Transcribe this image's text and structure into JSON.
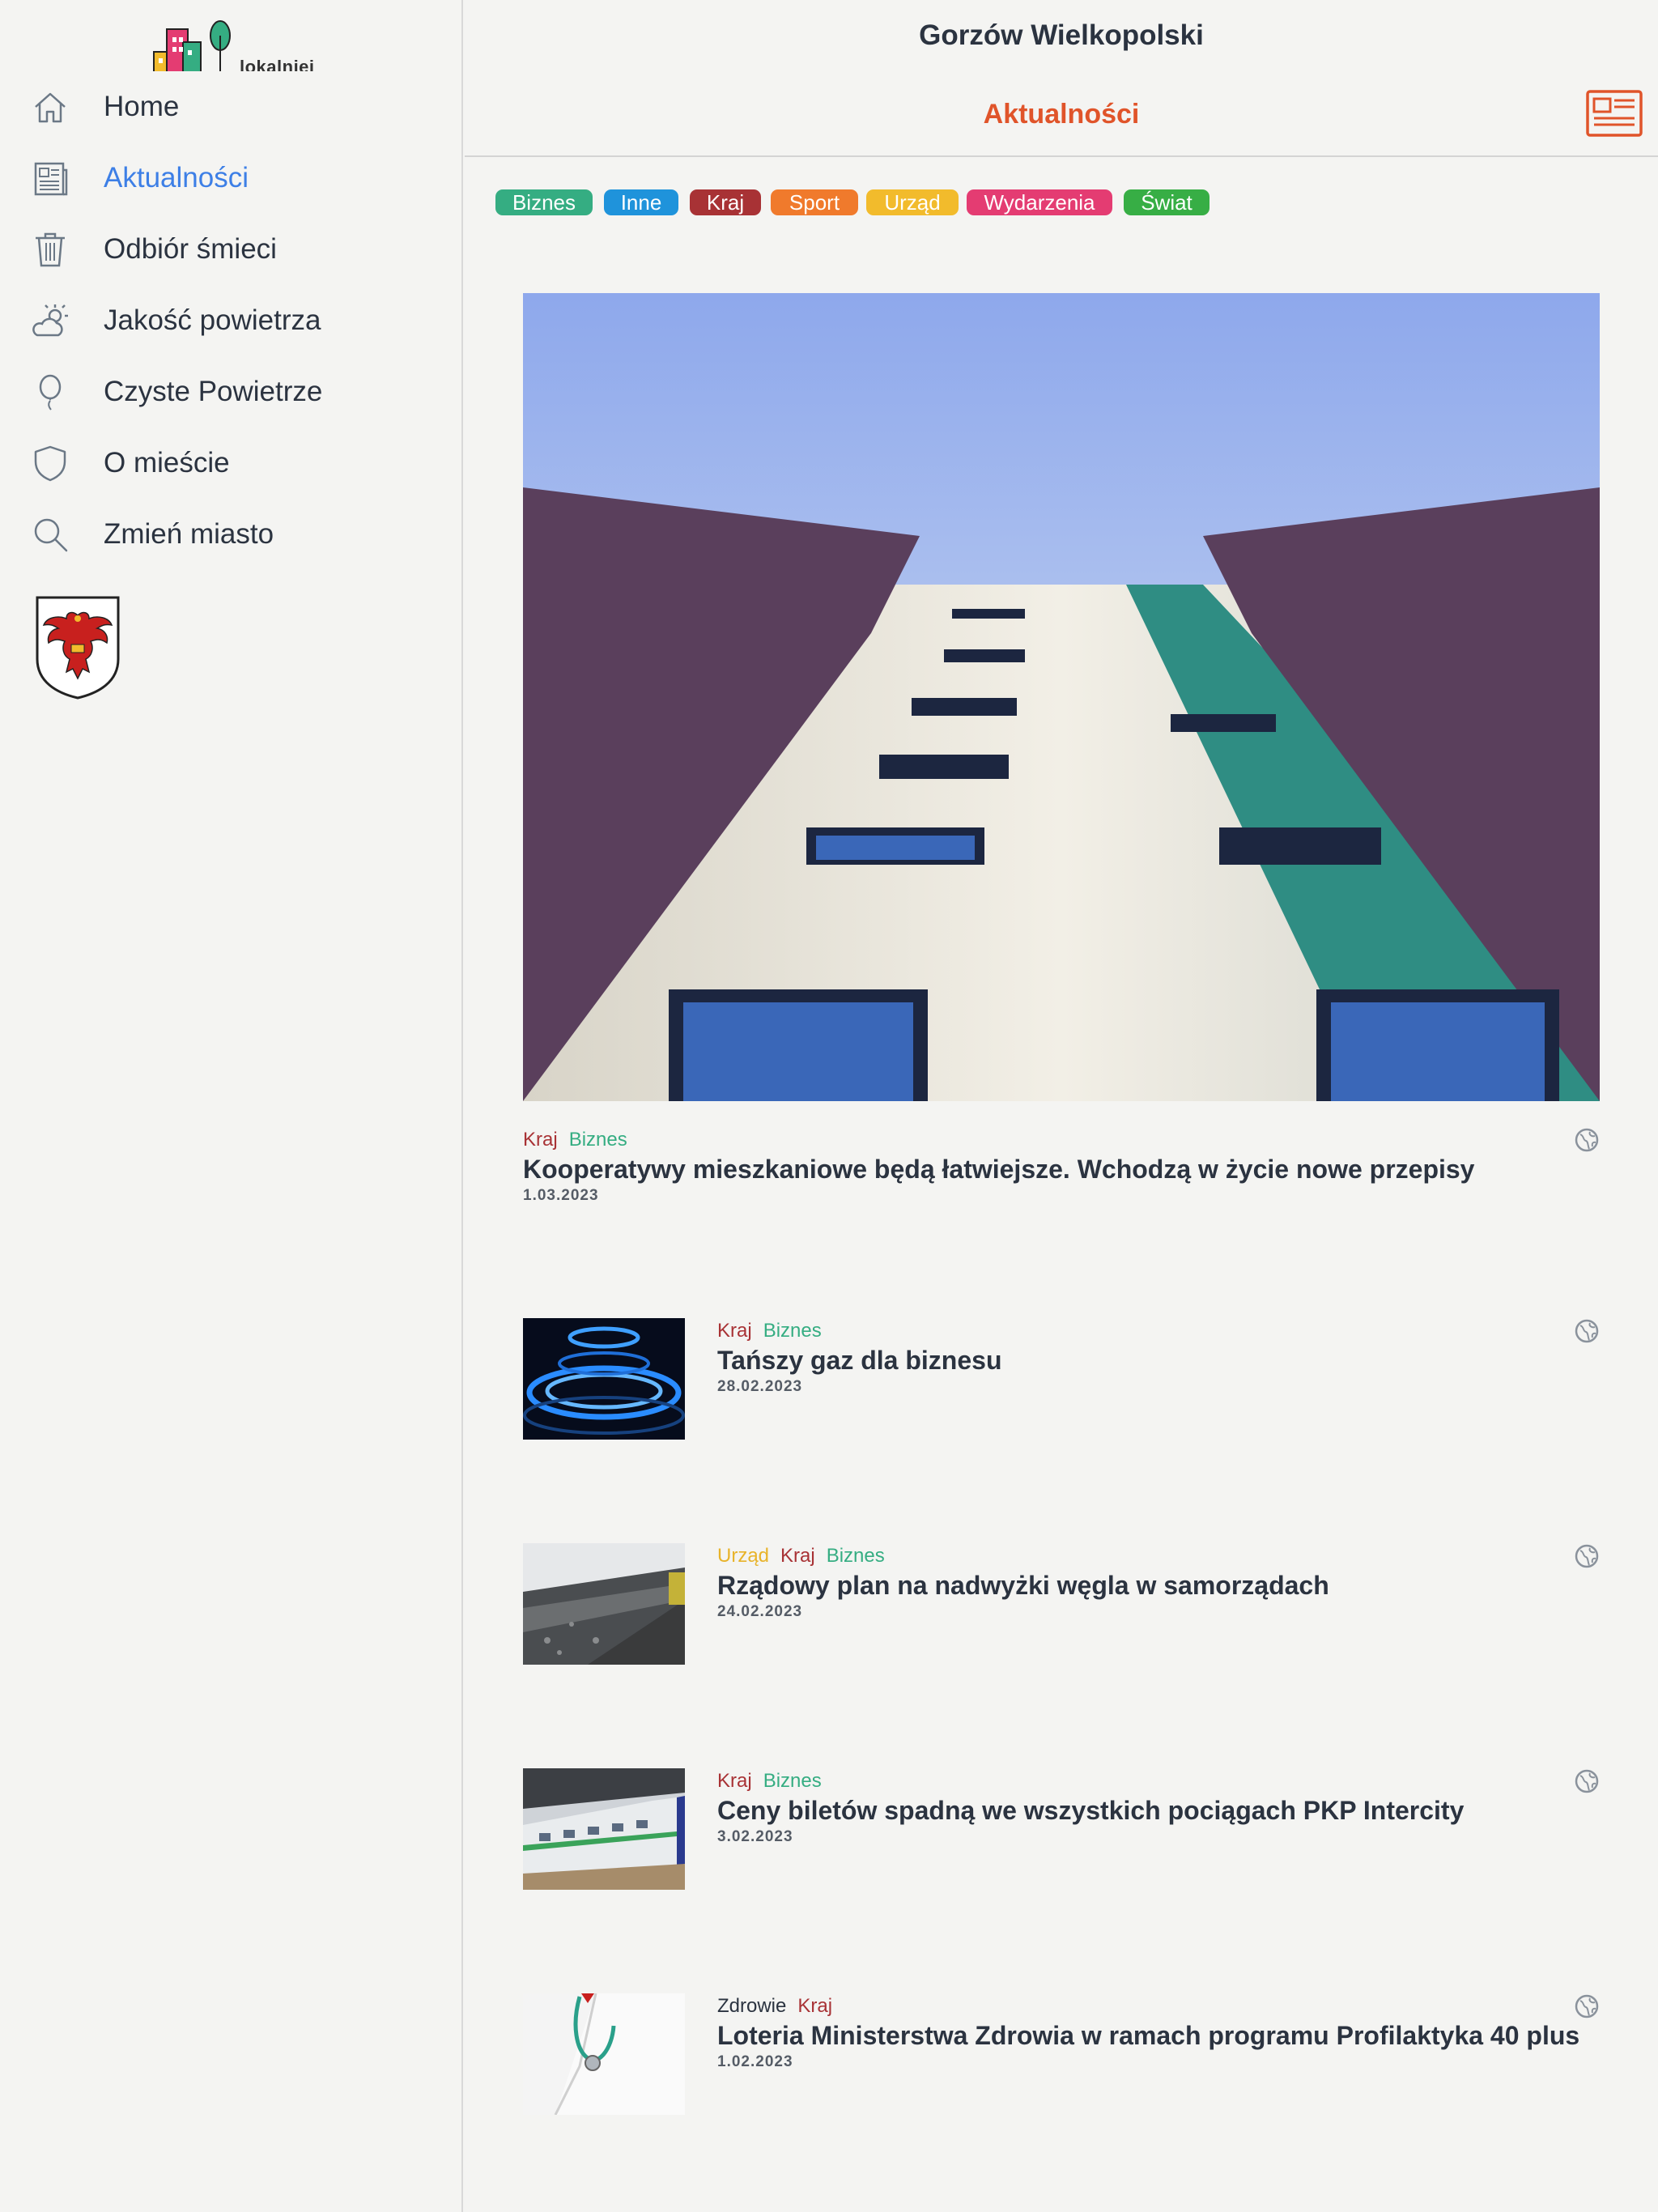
{
  "app": {
    "logo_text": "lokalniej"
  },
  "sidebar": {
    "items": [
      {
        "label": "Home",
        "icon": "home-icon"
      },
      {
        "label": "Aktualności",
        "icon": "newspaper-icon",
        "active": true
      },
      {
        "label": "Odbiór śmieci",
        "icon": "trash-icon"
      },
      {
        "label": "Jakość powietrza",
        "icon": "cloud-sun-icon"
      },
      {
        "label": "Czyste Powietrze",
        "icon": "balloon-icon"
      },
      {
        "label": "O mieście",
        "icon": "shield-icon"
      },
      {
        "label": "Zmień miasto",
        "icon": "search-icon"
      }
    ],
    "crest": "city-crest-icon"
  },
  "header": {
    "city": "Gorzów Wielkopolski",
    "title": "Aktualności"
  },
  "categories": [
    {
      "label": "Biznes",
      "color": "#35ad82"
    },
    {
      "label": "Inne",
      "color": "#1f93db"
    },
    {
      "label": "Kraj",
      "color": "#a83235"
    },
    {
      "label": "Sport",
      "color": "#f07a2c"
    },
    {
      "label": "Urząd",
      "color": "#f2bb2c"
    },
    {
      "label": "Wydarzenia",
      "color": "#e43c72"
    },
    {
      "label": "Świat",
      "color": "#37ae45"
    }
  ],
  "tag_colors": {
    "Kraj": "#a83235",
    "Biznes": "#35ad82",
    "Urząd": "#e8b32a",
    "Zdrowie": "#2b3340"
  },
  "articles": [
    {
      "tags": [
        "Kraj",
        "Biznes"
      ],
      "title": "Kooperatywy mieszkaniowe będą łatwiejsze. Wchodzą w życie nowe przepisy",
      "date": "1.03.2023"
    },
    {
      "tags": [
        "Kraj",
        "Biznes"
      ],
      "title": "Tańszy gaz dla biznesu",
      "date": "28.02.2023"
    },
    {
      "tags": [
        "Urząd",
        "Kraj",
        "Biznes"
      ],
      "title": "Rządowy plan na nadwyżki węgla w samorządach",
      "date": "24.02.2023"
    },
    {
      "tags": [
        "Kraj",
        "Biznes"
      ],
      "title": "Ceny biletów spadną we wszystkich pociągach PKP Intercity",
      "date": "3.02.2023"
    },
    {
      "tags": [
        "Zdrowie",
        "Kraj"
      ],
      "title": "Loteria Ministerstwa Zdrowia w ramach programu Profilaktyka 40 plus",
      "date": "1.02.2023"
    }
  ]
}
